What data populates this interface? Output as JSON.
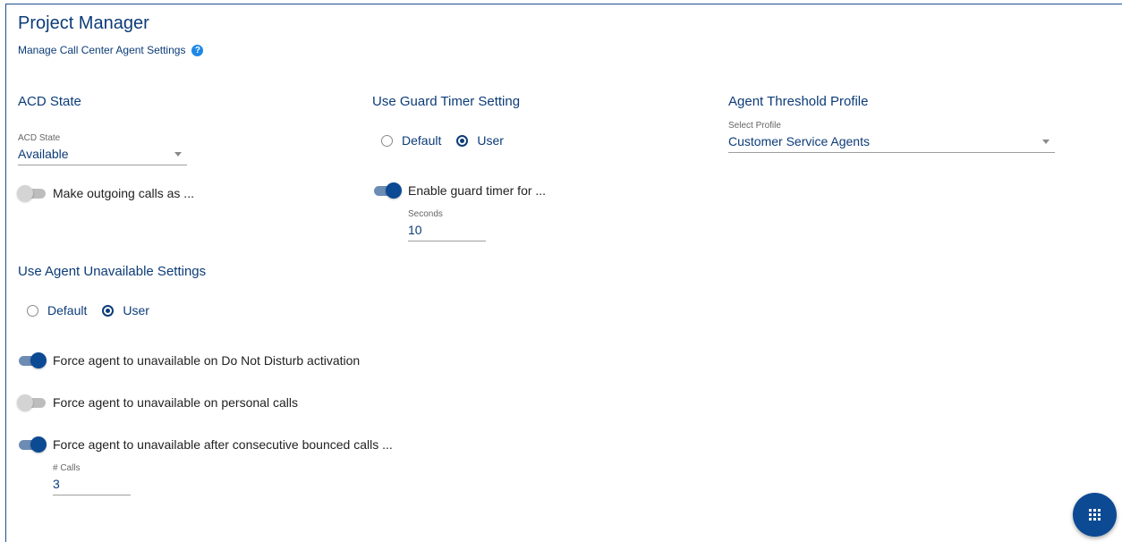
{
  "header": {
    "title": "Project Manager",
    "subtitle": "Manage Call Center Agent Settings",
    "help_glyph": "?"
  },
  "acd": {
    "section_title": "ACD State",
    "field_label": "ACD State",
    "selected": "Available",
    "outgoing_toggle_label": "Make outgoing calls as ...",
    "outgoing_toggle_on": false
  },
  "guard_timer": {
    "section_title": "Use Guard Timer Setting",
    "radio_default": "Default",
    "radio_user": "User",
    "selected_radio": "User",
    "toggle_label": "Enable guard timer for ...",
    "toggle_on": true,
    "seconds_label": "Seconds",
    "seconds_value": "10"
  },
  "threshold": {
    "section_title": "Agent Threshold Profile",
    "field_label": "Select Profile",
    "selected": "Customer Service Agents"
  },
  "unavailable": {
    "section_title": "Use Agent Unavailable Settings",
    "radio_default": "Default",
    "radio_user": "User",
    "selected_radio": "User",
    "toggles": [
      {
        "label": "Force agent to unavailable on Do Not Disturb activation",
        "on": true
      },
      {
        "label": "Force agent to unavailable on personal calls",
        "on": false
      },
      {
        "label": "Force agent to unavailable after consecutive bounced calls ...",
        "on": true
      }
    ],
    "calls_label": "# Calls",
    "calls_value": "3"
  },
  "colors": {
    "primary": "#0c3c78",
    "toggle_on": "#0c4a93",
    "help": "#1e88e5"
  },
  "icons": {
    "fab": "apps-grid-icon",
    "help": "help-circle-icon"
  }
}
